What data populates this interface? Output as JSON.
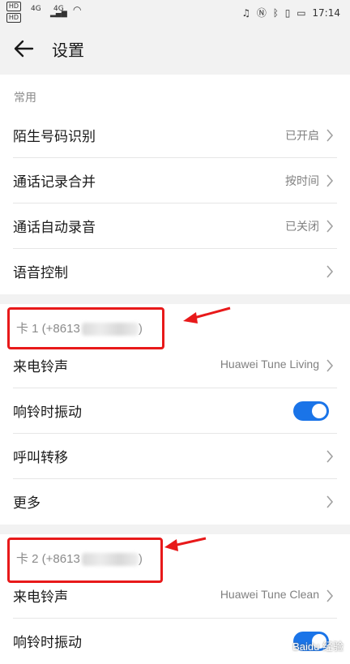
{
  "status_bar": {
    "left_icons": [
      "HD",
      "HD"
    ],
    "signal1": "4G",
    "signal2": "4G",
    "right_icons": [
      "headphones-icon",
      "nfc-icon",
      "bluetooth-icon",
      "vibrate-icon",
      "battery-icon"
    ],
    "time": "17:14"
  },
  "header": {
    "title": "设置"
  },
  "common": {
    "section_title": "常用",
    "items": [
      {
        "label": "陌生号码识别",
        "value": "已开启"
      },
      {
        "label": "通话记录合并",
        "value": "按时间"
      },
      {
        "label": "通话自动录音",
        "value": "已关闭"
      },
      {
        "label": "语音控制",
        "value": ""
      }
    ]
  },
  "card1": {
    "title": "卡 1 (+8613",
    "title_end": ")",
    "ringtone_label": "来电铃声",
    "ringtone_value": "Huawei Tune Living",
    "vibrate_label": "响铃时振动",
    "vibrate_on": true,
    "forward_label": "呼叫转移",
    "more_label": "更多"
  },
  "card2": {
    "title": "卡 2 (+8613",
    "title_end": ")",
    "ringtone_label": "来电铃声",
    "ringtone_value": "Huawei Tune Clean",
    "vibrate_label": "响铃时振动",
    "vibrate_on": true
  },
  "watermark": "Baidu 经验",
  "colors": {
    "accent": "#1a74e8",
    "highlight": "#e8191a"
  }
}
